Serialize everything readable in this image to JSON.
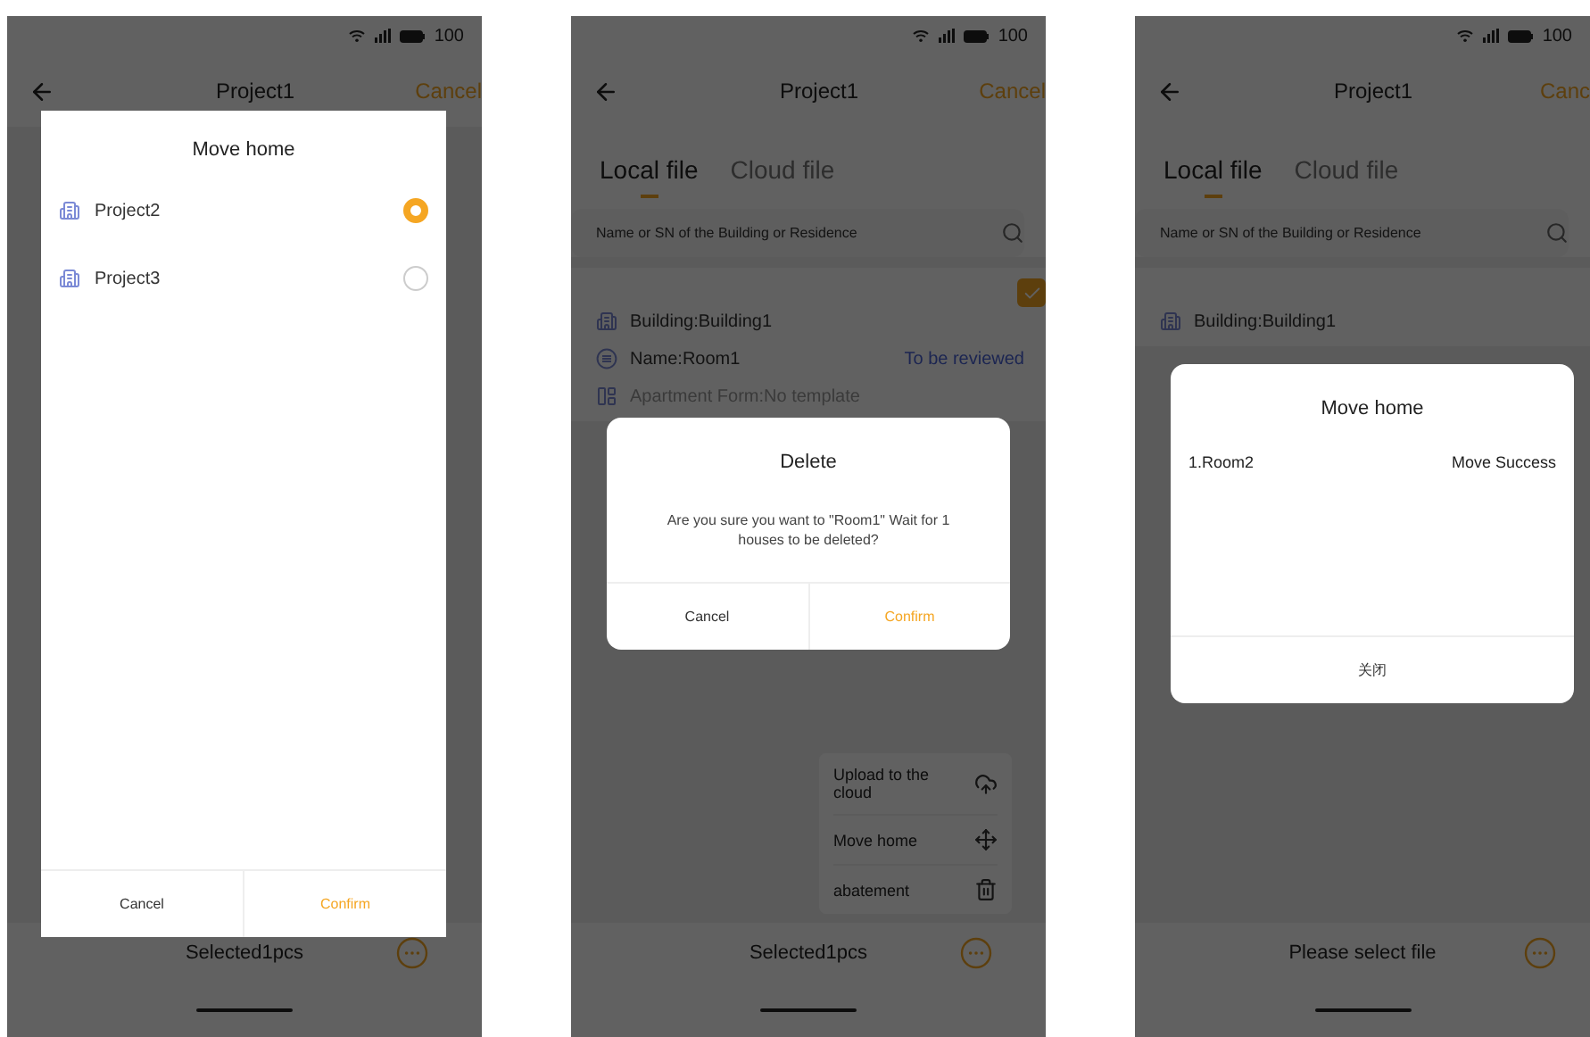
{
  "screens": [
    {
      "status_bar": {
        "battery": "100"
      },
      "header": {
        "title": "Project1",
        "action": "Cancel"
      },
      "bottom_bar": {
        "text": "Selected1pcs"
      },
      "dialog": {
        "kind": "picker",
        "title": "Move home",
        "options": [
          {
            "label": "Project2",
            "selected": true
          },
          {
            "label": "Project3",
            "selected": false
          }
        ],
        "buttons": [
          {
            "label": "Cancel",
            "kind": "secondary"
          },
          {
            "label": "Confirm",
            "kind": "primary"
          }
        ]
      }
    },
    {
      "status_bar": {
        "battery": "100"
      },
      "header": {
        "title": "Project1",
        "action": "Cancel"
      },
      "tabs": [
        {
          "label": "Local file",
          "selected": true
        },
        {
          "label": "Cloud file",
          "selected": false
        }
      ],
      "search": {
        "placeholder": "Name or SN of the Building or Residence"
      },
      "record": {
        "checked": true,
        "rows": [
          {
            "kind": "building",
            "text": "Building:Building1"
          },
          {
            "kind": "name",
            "text": "Name:Room1",
            "status": "To be reviewed"
          },
          {
            "kind": "form",
            "text": "Apartment Form:No template"
          }
        ]
      },
      "menu": [
        {
          "label": "Upload to the cloud",
          "kind": "upload"
        },
        {
          "label": "Move home",
          "kind": "move"
        },
        {
          "label": "abatement",
          "kind": "delete"
        }
      ],
      "bottom_bar": {
        "text": "Selected1pcs"
      },
      "dialog": {
        "kind": "confirm",
        "title": "Delete",
        "message": "Are you sure you want to \"Room1\" Wait for 1 houses to be deleted?",
        "buttons": [
          {
            "label": "Cancel",
            "kind": "secondary"
          },
          {
            "label": "Confirm",
            "kind": "primary"
          }
        ]
      }
    },
    {
      "status_bar": {
        "battery": "100"
      },
      "header": {
        "title": "Project1",
        "action": "Canc"
      },
      "tabs": [
        {
          "label": "Local file",
          "selected": true
        },
        {
          "label": "Cloud file",
          "selected": false
        }
      ],
      "search": {
        "placeholder": "Name or SN of the Building or Residence"
      },
      "record": {
        "rows": [
          {
            "kind": "building",
            "text": "Building:Building1"
          }
        ]
      },
      "bottom_bar": {
        "text": "Please select file"
      },
      "dialog": {
        "kind": "result",
        "title": "Move home",
        "results": [
          {
            "name": "1.Room2",
            "status": "Move Success"
          }
        ],
        "buttons": [
          {
            "label": "关闭",
            "kind": "secondary"
          }
        ]
      }
    }
  ]
}
